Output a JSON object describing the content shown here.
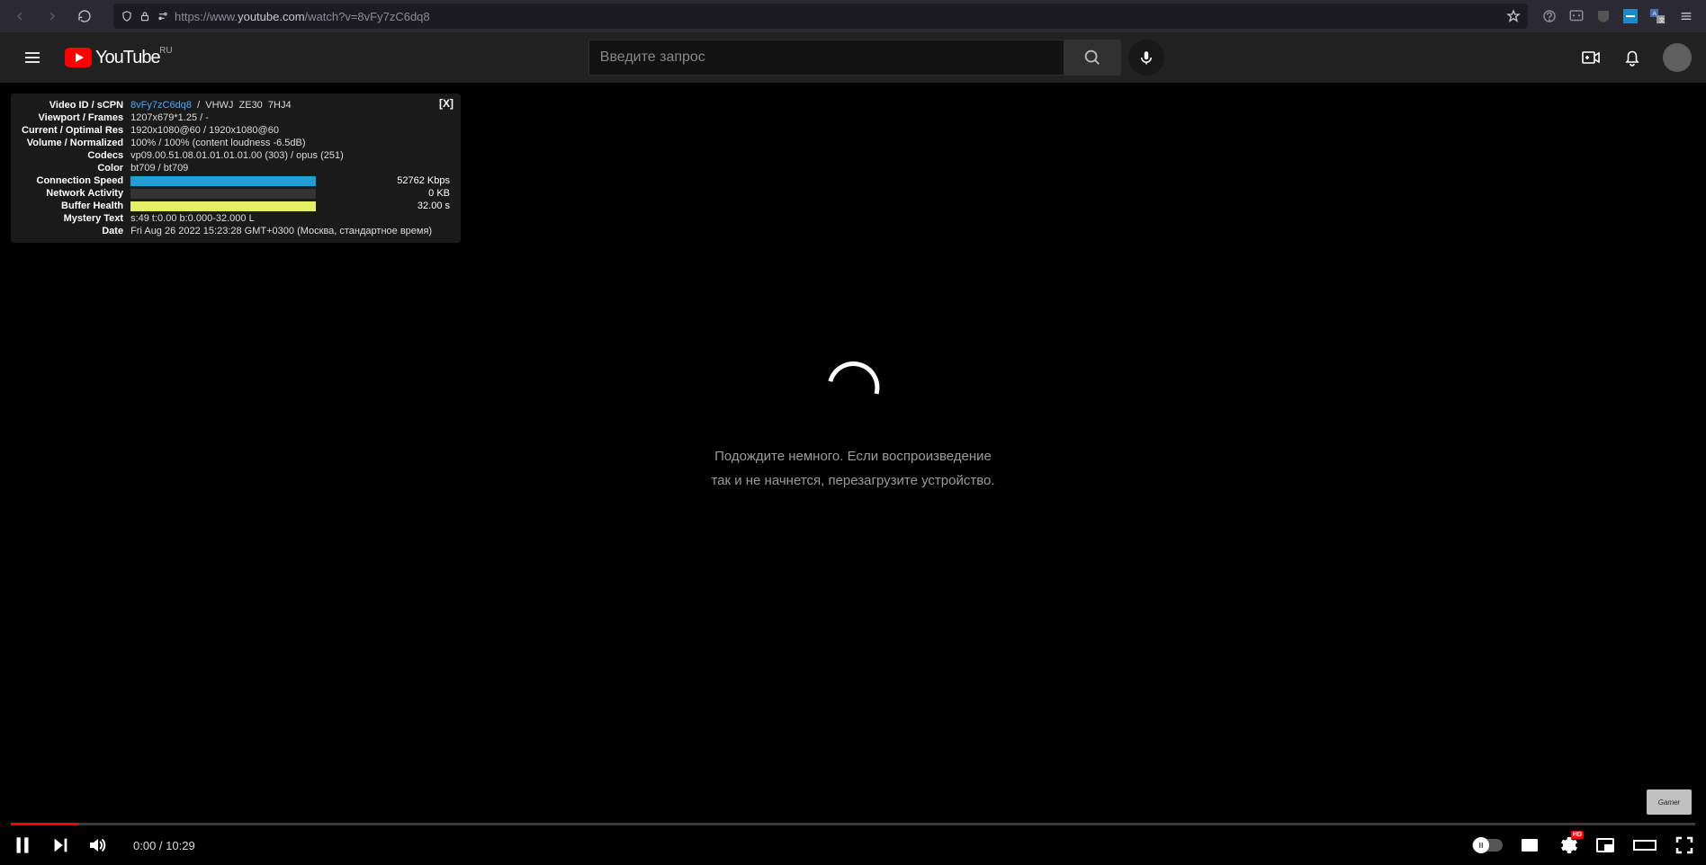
{
  "browser": {
    "url_scheme": "https://",
    "url_host": "www.",
    "url_main": "youtube.com",
    "url_path": "/watch?v=8vFy7zC6dq8"
  },
  "masthead": {
    "logo_text": "YouTube",
    "country": "RU",
    "search_placeholder": "Введите запрос"
  },
  "stats": {
    "close": "[X]",
    "rows": [
      {
        "k": "Video ID / sCPN",
        "v_html": "<span class='val-accent'>8vFy7zC6dq8</span>&nbsp;&nbsp;/&nbsp;&nbsp;VHWJ&nbsp;&nbsp;ZE30&nbsp;&nbsp;7HJ4"
      },
      {
        "k": "Viewport / Frames",
        "v": "1207x679*1.25 / -"
      },
      {
        "k": "Current / Optimal Res",
        "v": "1920x1080@60 / 1920x1080@60"
      },
      {
        "k": "Volume / Normalized",
        "v": "100% / 100% (content loudness -6.5dB)"
      },
      {
        "k": "Codecs",
        "v": "vp09.00.51.08.01.01.01.01.00 (303) / opus (251)"
      },
      {
        "k": "Color",
        "v": "bt709 / bt709"
      }
    ],
    "bar_rows": [
      {
        "k": "Connection Speed",
        "color": "#1ea0d6",
        "pct": 100,
        "r": "52762 Kbps"
      },
      {
        "k": "Network Activity",
        "color": "#1ea0d6",
        "pct": 0,
        "r": "0 KB"
      },
      {
        "k": "Buffer Health",
        "color": "#e4ef65",
        "pct": 100,
        "r": "32.00 s"
      }
    ],
    "tail_rows": [
      {
        "k": "Mystery Text",
        "v": "s:49 t:0.00 b:0.000-32.000 L"
      },
      {
        "k": "Date",
        "v": "Fri Aug 26 2022 15:23:28 GMT+0300 (Москва, стандартное время)"
      }
    ]
  },
  "spinner_msg_l1": "Подождите немного. Если воспроизведение",
  "spinner_msg_l2": "так и не начнется, перезагрузите устройство.",
  "watermark": "Gamer",
  "player": {
    "time": "0:00 / 10:29",
    "hd": "HD"
  }
}
